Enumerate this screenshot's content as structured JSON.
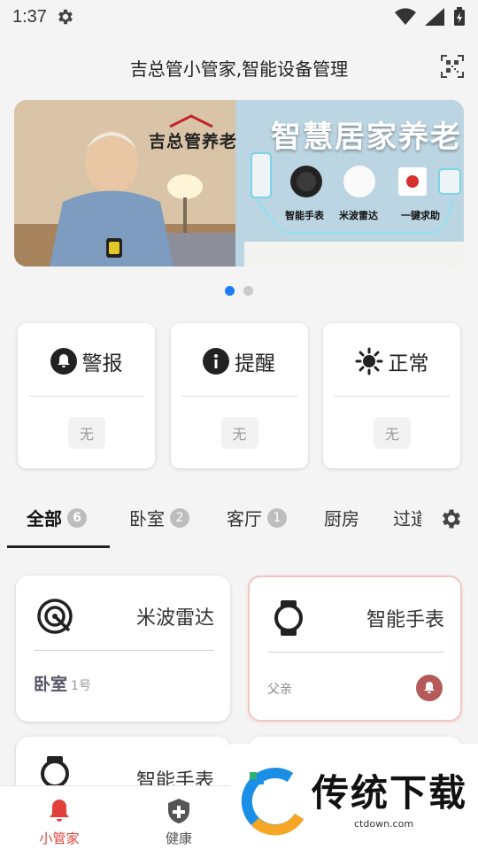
{
  "status_bar": {
    "time": "1:37"
  },
  "header": {
    "title": "吉总管小管家,智能设备管理"
  },
  "banner": {
    "brand": "吉总管养老",
    "headline": "智慧居家养老",
    "devices": [
      "智能手表",
      "米波雷达",
      "一键求助"
    ],
    "page_count": 2,
    "active_page": 1
  },
  "status_cards": [
    {
      "label": "警报",
      "icon": "bell-icon",
      "value": "无"
    },
    {
      "label": "提醒",
      "icon": "info-icon",
      "value": "无"
    },
    {
      "label": "正常",
      "icon": "sun-icon",
      "value": "无"
    }
  ],
  "tabs": [
    {
      "label": "全部",
      "count": "6",
      "active": true
    },
    {
      "label": "卧室",
      "count": "2"
    },
    {
      "label": "客厅",
      "count": "1"
    },
    {
      "label": "厨房"
    },
    {
      "label": "过道"
    }
  ],
  "devices": [
    {
      "name": "米波雷达",
      "icon": "radar-icon",
      "room": "卧室",
      "room_no": "1号",
      "alert": false
    },
    {
      "name": "智能手表",
      "icon": "watch-icon",
      "owner": "父亲",
      "alert": true
    },
    {
      "name": "智能手表",
      "icon": "watch-icon"
    }
  ],
  "bottom_nav": [
    {
      "label": "小管家",
      "icon": "bell-icon",
      "active": true
    },
    {
      "label": "健康",
      "icon": "shield-plus-icon",
      "active": false
    }
  ],
  "watermark": {
    "text": "传统下载",
    "url": "ctdown.com"
  },
  "colors": {
    "accent": "#1e7cf2",
    "alert": "#e0413b",
    "alert_badge": "#b55a5a"
  }
}
